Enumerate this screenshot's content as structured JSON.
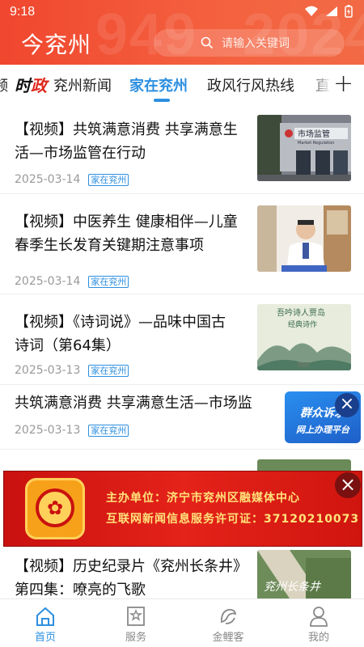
{
  "status": {
    "time": "9:18"
  },
  "header": {
    "title": "今兖州",
    "search_placeholder": "请输入关键词",
    "bg_year_left": "949",
    "bg_year_right": "2024"
  },
  "tabs": {
    "partial_left": "频",
    "logo_a": "时",
    "logo_b": "政",
    "items": [
      "兖州新闻",
      "家在兖州",
      "政风行风热线",
      "直"
    ],
    "active_index": 1,
    "add_icon": "plus-icon"
  },
  "feed": [
    {
      "title": "【视频】共筑满意消费  共享满意生活—市场监管在行动",
      "date": "2025-03-14",
      "tag": "家在兖州"
    },
    {
      "title": "【视频】中医养生  健康相伴—儿童春季生长发育关键期注意事项",
      "date": "2025-03-14",
      "tag": "家在兖州"
    },
    {
      "title": "【视频】《诗词说》—品味中国古诗词（第64集）",
      "date": "2025-03-13",
      "tag": "家在兖州"
    },
    {
      "title": "共筑满意消费  共享满意生活—市场监",
      "date": "2025-03-13",
      "tag": "家在兖州"
    },
    {
      "title": "【视频】历史纪录片《兖州长条井》第四集：嘹亮的飞歌"
    }
  ],
  "thumbs": {
    "t1_sign": "市场监管",
    "t1_sign_en": "Market Regulation",
    "t3_line1": "吾吟诗人贾岛",
    "t3_line2": "经典诗作",
    "t5_text": "兖州长条井"
  },
  "float_widget": {
    "line1": "群众诉求",
    "line2": "网上办理平台"
  },
  "banner": {
    "line1": "主办单位：济宁市兖州区融媒体中心",
    "line2": "互联网新闻信息服务许可证：37120210073"
  },
  "bottom_nav": [
    {
      "label": "首页",
      "icon": "home-icon",
      "active": true
    },
    {
      "label": "服务",
      "icon": "service-icon",
      "active": false
    },
    {
      "label": "金鲤客",
      "icon": "carp-icon",
      "active": false
    },
    {
      "label": "我的",
      "icon": "user-icon",
      "active": false
    }
  ],
  "colors": {
    "header": "#f0472f",
    "accent": "#2d8fe0",
    "banner": "#d0150f"
  }
}
